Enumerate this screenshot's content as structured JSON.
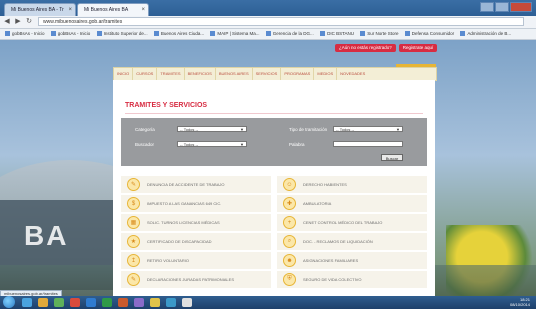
{
  "browser": {
    "tabs": [
      {
        "label": "Mi Buenos Aires BA - Tr",
        "active": false
      },
      {
        "label": "Mi Buenos Aires BA",
        "active": true
      }
    ],
    "url": "www.mibuenosaires.gob.ar/tramites",
    "bookmarks": [
      "gobBsAs - Inicio",
      "gobBsAs - Inicio",
      "Instituto Superior de...",
      "Buenos Aires Ciuda...",
      "MAIP | Sistema Ma...",
      "Gerencia de la DG...",
      "DIC BSTANU",
      "Sur Norte Store",
      "Defensa Consumidor",
      "Administración de B..."
    ],
    "status_url": "mibuenosaires.gob.ar/tramites"
  },
  "site": {
    "header_links": [
      "¿Aún no estás registrado?",
      "Registrate aquí"
    ],
    "nav": [
      "INICIO",
      "CURSOS",
      "TRAMITES",
      "BENEFICIOS",
      "BUENOS AIRES",
      "SERVICIOS",
      "PROGRAMAS",
      "MEDIOS",
      "NOVEDADES"
    ],
    "page_title": "TRAMITES Y SERVICIOS",
    "filter": {
      "categoria_label": "Categoría",
      "categoria_value": "-- Todos --",
      "tipo_label": "Tipo de tramitación",
      "tipo_value": "-- Todos --",
      "buscador_label": "Buscador",
      "buscador_value": "-- Todos --",
      "palabra_label": "Palabra",
      "palabra_value": "",
      "buscar_label": "Buscar"
    },
    "services": [
      {
        "label": "DENUNCIA DE ACCIDENTE DE TRABAJO",
        "icon": "document-icon"
      },
      {
        "label": "DERECHO HABIENTES",
        "icon": "people-icon"
      },
      {
        "label": "IMPUESTO A LAS GANANCIAS 649 CIC.",
        "icon": "tax-icon"
      },
      {
        "label": "AMBULATORIA",
        "icon": "ambulance-icon"
      },
      {
        "label": "SOLIC. TURNOS LICENCIAS MÉDICAS",
        "icon": "calendar-icon"
      },
      {
        "label": "CENET CONTROL MÉDICO DEL TRABAJO",
        "icon": "medical-cross-icon"
      },
      {
        "label": "CERTIFICADO DE DISCAPACIDAD",
        "icon": "certificate-icon"
      },
      {
        "label": "DOC. - RECLAMOS DE LIQUIDACIÓN",
        "icon": "search-icon"
      },
      {
        "label": "RETIRO VOLUNTARIO",
        "icon": "exit-icon"
      },
      {
        "label": "ASIGNACIONES FAMILIARES",
        "icon": "family-icon"
      },
      {
        "label": "DECLARACIONES JURADAS PATRIMONIALES",
        "icon": "document-icon"
      },
      {
        "label": "SEGURO DE VIDA COLECTIVO",
        "icon": "shield-icon"
      }
    ]
  },
  "taskbar": {
    "time": "18:21",
    "date": "08/10/2014"
  }
}
